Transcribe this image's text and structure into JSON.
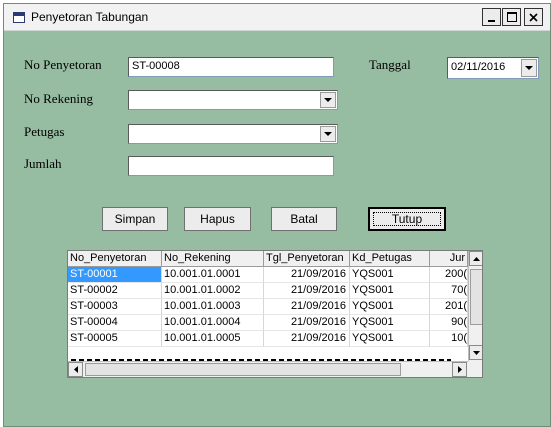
{
  "window": {
    "title": "Penyetoran Tabungan"
  },
  "form": {
    "no_penyetoran_label": "No Penyetoran",
    "no_penyetoran_value": "ST-00008",
    "tanggal_label": "Tanggal",
    "tanggal_value": "02/11/2016",
    "no_rekening_label": "No Rekening",
    "no_rekening_value": "",
    "petugas_label": "Petugas",
    "petugas_value": "",
    "jumlah_label": "Jumlah",
    "jumlah_value": ""
  },
  "buttons": {
    "simpan": "Simpan",
    "hapus": "Hapus",
    "batal": "Batal",
    "tutup": "Tutup"
  },
  "grid": {
    "columns": [
      "No_Penyetoran",
      "No_Rekening",
      "Tgl_Penyetoran",
      "Kd_Petugas",
      "Jur"
    ],
    "rows": [
      [
        "ST-00001",
        "10.001.01.0001",
        "21/09/2016",
        "YQS001",
        "200("
      ],
      [
        "ST-00002",
        "10.001.01.0002",
        "21/09/2016",
        "YQS001",
        "70("
      ],
      [
        "ST-00003",
        "10.001.01.0003",
        "21/09/2016",
        "YQS001",
        "201("
      ],
      [
        "ST-00004",
        "10.001.01.0004",
        "21/09/2016",
        "YQS001",
        "90("
      ],
      [
        "ST-00005",
        "10.001.01.0005",
        "21/09/2016",
        "YQS001",
        "10("
      ]
    ]
  }
}
